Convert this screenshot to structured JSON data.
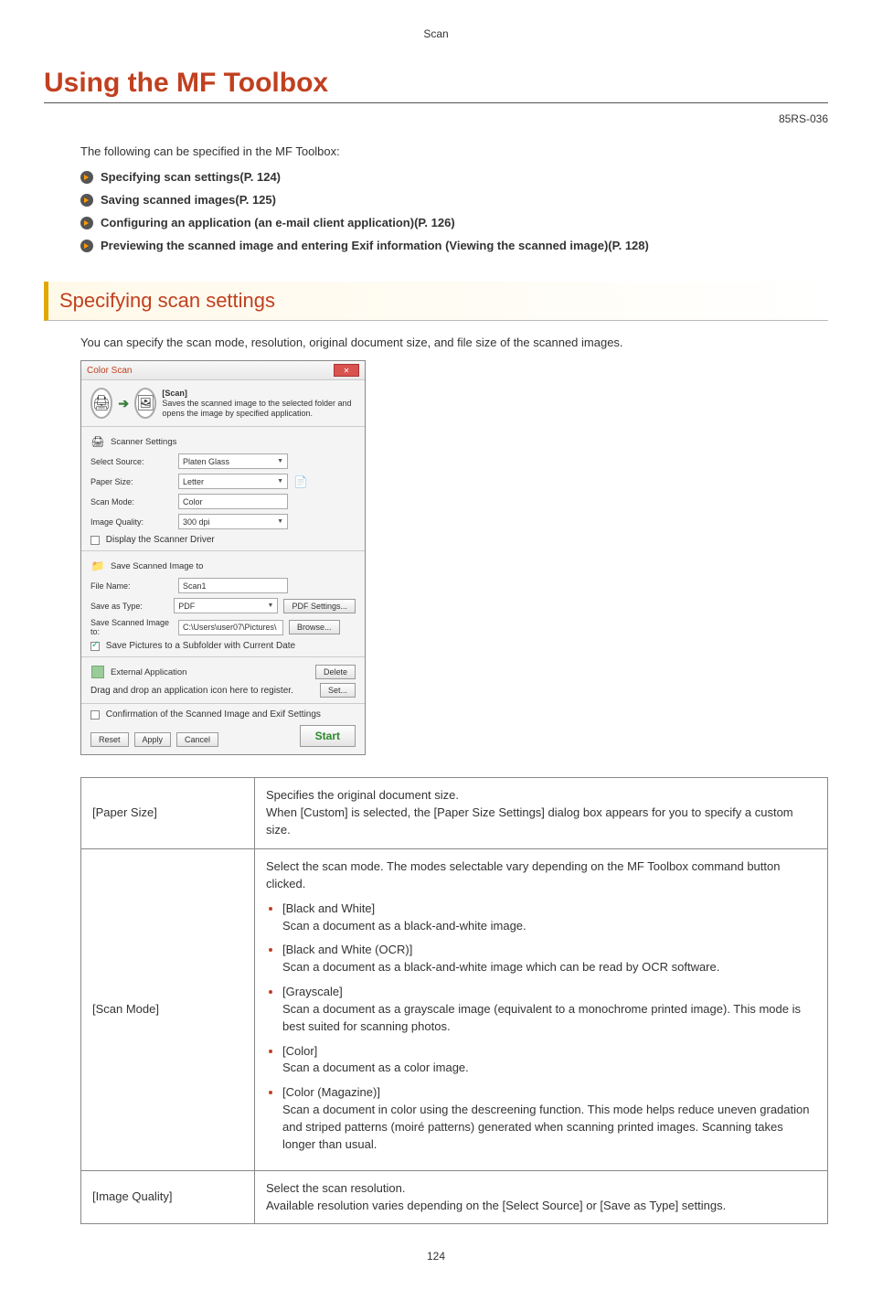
{
  "breadcrumb": "Scan",
  "title": "Using the MF Toolbox",
  "doc_id": "85RS-036",
  "intro_text": "The following can be specified in the MF Toolbox:",
  "links": [
    "Specifying scan settings(P. 124)",
    "Saving scanned images(P. 125)",
    "Configuring an application (an e-mail client application)(P. 126)",
    "Previewing the scanned image and entering Exif information (Viewing the scanned image)(P. 128)"
  ],
  "section_heading": "Specifying scan settings",
  "section_intro": "You can specify the scan mode, resolution, original document size, and file size of the scanned images.",
  "dialog": {
    "title": "Color Scan",
    "scan_label": "[Scan]",
    "scan_desc": "Saves the scanned image to the selected folder and opens the image by specified application.",
    "scanner_settings": "Scanner Settings",
    "rows": {
      "select_source": {
        "label": "Select Source:",
        "value": "Platen Glass"
      },
      "paper_size": {
        "label": "Paper Size:",
        "value": "Letter"
      },
      "scan_mode": {
        "label": "Scan Mode:",
        "value": "Color"
      },
      "image_quality": {
        "label": "Image Quality:",
        "value": "300 dpi"
      }
    },
    "display_driver": "Display the Scanner Driver",
    "save_head": "Save Scanned Image to",
    "file_name": {
      "label": "File Name:",
      "value": "Scan1"
    },
    "save_as_type": {
      "label": "Save as Type:",
      "value": "PDF",
      "btn": "PDF Settings..."
    },
    "save_to": {
      "label": "Save Scanned Image to:",
      "value": "C:\\Users\\user07\\Pictures\\",
      "btn": "Browse..."
    },
    "save_subfolder": "Save Pictures to a Subfolder with Current Date",
    "ext_app": "External Application",
    "ext_app_note": "Drag and drop an application icon here to register.",
    "delete_btn": "Delete",
    "set_btn": "Set...",
    "confirm": "Confirmation of the Scanned Image and Exif Settings",
    "reset": "Reset",
    "apply": "Apply",
    "cancel": "Cancel",
    "start": "Start"
  },
  "table": {
    "rows": [
      {
        "label": "[Paper Size]",
        "body": "Specifies the original document size.\nWhen [Custom] is selected, the [Paper Size Settings] dialog box appears for you to specify a custom size."
      },
      {
        "label": "[Scan Mode]",
        "intro": "Select the scan mode. The modes selectable vary depending on the MF Toolbox command button clicked.",
        "items": [
          {
            "name": "[Black and White]",
            "desc": "Scan a document as a black-and-white image."
          },
          {
            "name": "[Black and White (OCR)]",
            "desc": "Scan a document as a black-and-white image which can be read by OCR software."
          },
          {
            "name": "[Grayscale]",
            "desc": "Scan a document as a grayscale image (equivalent to a monochrome printed image). This mode is best suited for scanning photos."
          },
          {
            "name": "[Color]",
            "desc": "Scan a document as a color image."
          },
          {
            "name": "[Color (Magazine)]",
            "desc": "Scan a document in color using the descreening function. This mode helps reduce uneven gradation and striped patterns (moiré patterns) generated when scanning printed images. Scanning takes longer than usual."
          }
        ]
      },
      {
        "label": "[Image Quality]",
        "body": "Select the scan resolution.\nAvailable resolution varies depending on the [Select Source] or [Save as Type] settings."
      }
    ]
  },
  "page_number": "124"
}
